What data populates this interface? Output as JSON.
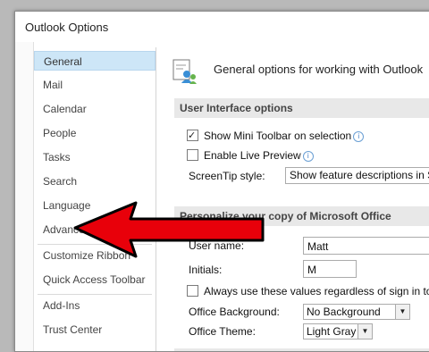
{
  "window": {
    "title": "Outlook Options"
  },
  "nav": {
    "items": [
      {
        "label": "General",
        "selected": true
      },
      {
        "label": "Mail"
      },
      {
        "label": "Calendar"
      },
      {
        "label": "People"
      },
      {
        "label": "Tasks"
      },
      {
        "label": "Search"
      },
      {
        "label": "Language"
      },
      {
        "label": "Advanced"
      },
      {
        "label": "Customize Ribbon"
      },
      {
        "label": "Quick Access Toolbar"
      },
      {
        "label": "Add-Ins"
      },
      {
        "label": "Trust Center"
      }
    ]
  },
  "content": {
    "header": "General options for working with Outlook",
    "ui_section": {
      "title": "User Interface options",
      "mini_toolbar_label": "Show Mini Toolbar on selection",
      "mini_toolbar_checked": true,
      "live_preview_label": "Enable Live Preview",
      "live_preview_checked": false,
      "screentip_label": "ScreenTip style:",
      "screentip_value": "Show feature descriptions in ScreenTips"
    },
    "personalize_section": {
      "title": "Personalize your copy of Microsoft Office",
      "user_name_label": "User name:",
      "user_name_value": "Matt",
      "initials_label": "Initials:",
      "initials_value": "M",
      "always_use_label": "Always use these values regardless of sign in to Office",
      "always_use_checked": false,
      "background_label": "Office Background:",
      "background_value": "No Background",
      "theme_label": "Office Theme:",
      "theme_value": "Light Gray"
    }
  },
  "colors": {
    "selected_nav": "#cde6f7",
    "annotation_arrow": "#e8000a"
  }
}
